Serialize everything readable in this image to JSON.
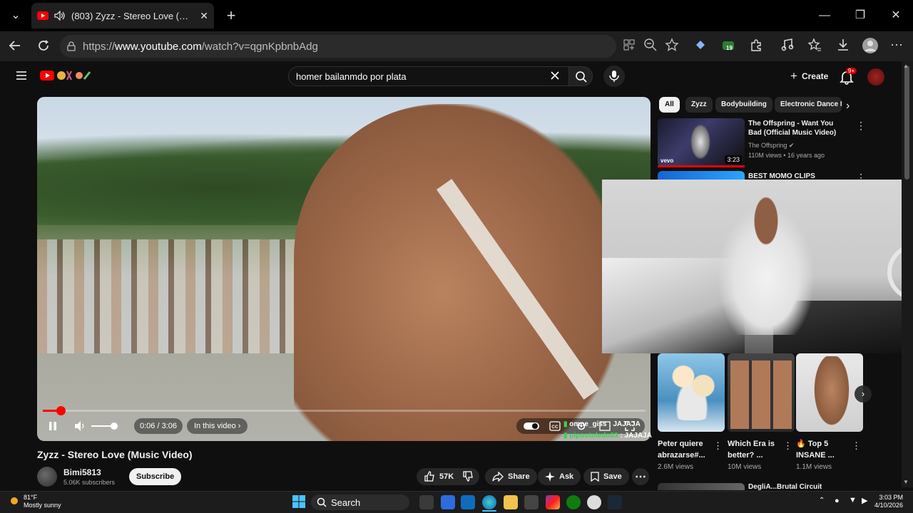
{
  "browser": {
    "tab_title": "(803) Zyzz - Stereo Love (Music Video)",
    "url_prefix": "https://",
    "url_host": "www.youtube.com",
    "url_path": "/watch?v=qgnKpbnbAdg",
    "extension_badge": "19"
  },
  "youtube": {
    "search_value": "homer bailanmdo por plata",
    "create_label": "Create",
    "notif_badge": "9+"
  },
  "player": {
    "time_current": "0:06",
    "time_sep": " / ",
    "time_total": "3:06",
    "chapter_label": "In this video",
    "progress_fraction": 0.03,
    "chat": [
      {
        "user": "omne_giss",
        "msg": "JAJAJA"
      },
      {
        "user": "pipootoledo03",
        "msg": "JAJAJA"
      }
    ]
  },
  "video": {
    "title": "Zyzz - Stereo Love (Music Video)",
    "channel": "Bimi5813",
    "subscribers": "5.06K subscribers",
    "subscribe_label": "Subscribe",
    "likes": "57K",
    "share_label": "Share",
    "ask_label": "Ask",
    "save_label": "Save"
  },
  "sidebar": {
    "chips": [
      "All",
      "Zyzz",
      "Bodybuilding",
      "Electronic Dance M"
    ],
    "recs": [
      {
        "title": "The Offspring - Want You Bad (Official Music Video)",
        "channel": "The Offspring",
        "meta": "110M views • 16 years ago",
        "duration": "3:23",
        "brand": "vevo"
      },
      {
        "title": "BEST MOMO CLIPS"
      }
    ],
    "shorts": [
      {
        "title": "Peter quiere abrazarse#...",
        "views": "2.6M views"
      },
      {
        "title": "Which Era is better? ...",
        "views": "10M views"
      },
      {
        "title": "🔥 Top 5 INSANE ...",
        "views": "1.1M views"
      }
    ],
    "next_rec_title": "DegliА...Brutal Circuit"
  },
  "taskbar": {
    "temp": "81°F",
    "weather": "Mostly sunny",
    "search_label": "Search",
    "time": "3:03 PM",
    "date": "4/10/2026"
  },
  "colors": {
    "accent_red": "#ff0000",
    "bg": "#0f0f0f",
    "chat_green": "#39d353"
  }
}
